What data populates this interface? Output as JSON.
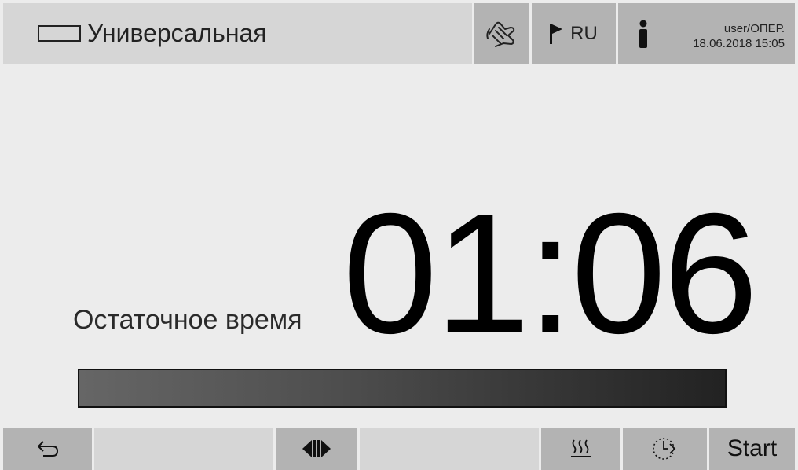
{
  "header": {
    "program_title": "Универсальная",
    "program_icon": "empty-rectangle-icon",
    "hand_icon": "hand-touch-icon",
    "language": {
      "icon": "flag-icon",
      "label": "RU"
    },
    "user": {
      "icon": "person-icon",
      "name": "user/ОПЕР.",
      "datetime": "18.06.2018 15:05"
    }
  },
  "main": {
    "remaining_label": "Остаточное время",
    "remaining_time": "01:06",
    "progress_fraction": 1.0
  },
  "footer": {
    "back_icon": "back-arrow-icon",
    "navigate_icon": "left-right-arrows-icon",
    "dry_icon": "heat-waves-icon",
    "timer_icon": "delayed-start-icon",
    "start_label": "Start"
  },
  "colors": {
    "background": "#ececec",
    "title_bar": "#d6d6d6",
    "button": "#b3b3b3",
    "progress_dark": "#222222",
    "progress_light": "#666666"
  }
}
